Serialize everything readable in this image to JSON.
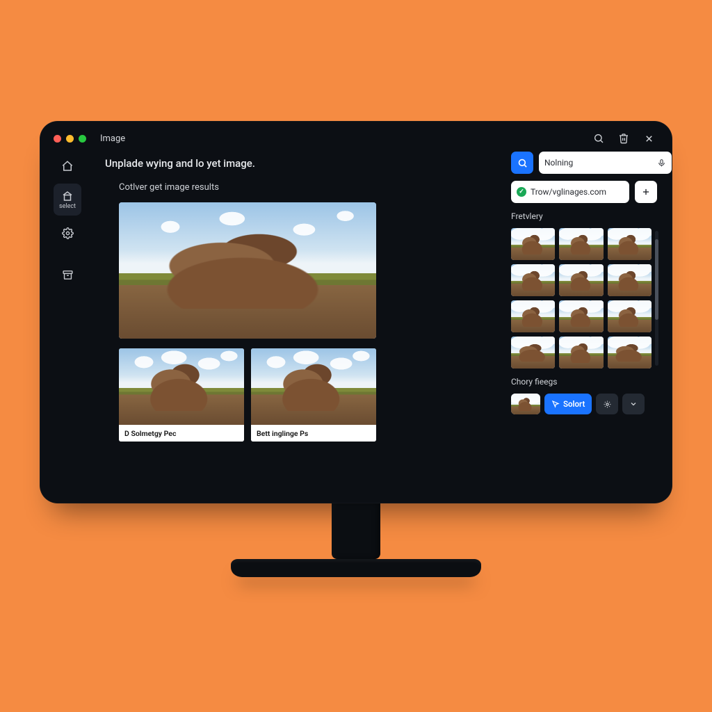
{
  "window": {
    "title": "Image"
  },
  "sidebar": {
    "items": [
      {
        "icon": "home-icon",
        "label": ""
      },
      {
        "icon": "library-icon",
        "label": "select"
      },
      {
        "icon": "settings-icon",
        "label": ""
      },
      {
        "icon": "archive-icon",
        "label": ""
      }
    ]
  },
  "main": {
    "headline": "Unplade wying and lo yet image.",
    "subhead": "Cotlver get image results",
    "cards": [
      {
        "caption": "D Solmetgy Pec"
      },
      {
        "caption": "Bett inglinge Ps"
      }
    ]
  },
  "panel": {
    "search_value": "Nolning",
    "source": "Trow/vglinages.com",
    "section1": "Fretvlery",
    "section2": "Chory fieegs",
    "select_label": "Solort"
  }
}
